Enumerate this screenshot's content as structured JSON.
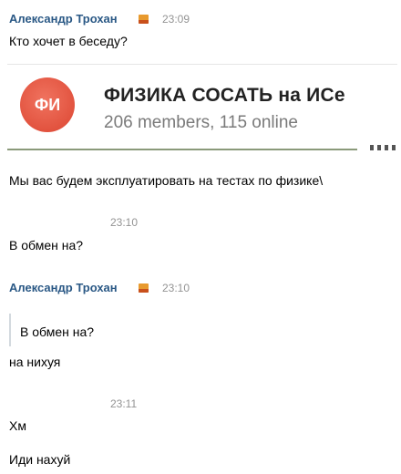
{
  "messages": [
    {
      "author": "Александр Трохан",
      "time": "23:09",
      "text": "Кто хочет в беседу?"
    },
    {
      "text": "Мы вас будем эксплуатировать на тестах по физике\\"
    },
    {
      "time": "23:10",
      "text": "В обмен на?"
    },
    {
      "author": "Александр Трохан",
      "time": "23:10",
      "quote": "В обмен на?",
      "text": "на нихуя"
    },
    {
      "time": "23:11",
      "text": "Хм"
    },
    {
      "text": "Иди нахуй"
    }
  ],
  "embed": {
    "avatar_text": "ФИ",
    "title": "ФИЗИКА СОСАТЬ на ИСе",
    "subtitle": "206 members, 115 online"
  },
  "colors": {
    "author": "#2a5885",
    "time": "#939393",
    "avatar": "#e2533f",
    "quote_border": "#d3d9de"
  },
  "icons": {
    "author_badge": "flag-icon"
  }
}
